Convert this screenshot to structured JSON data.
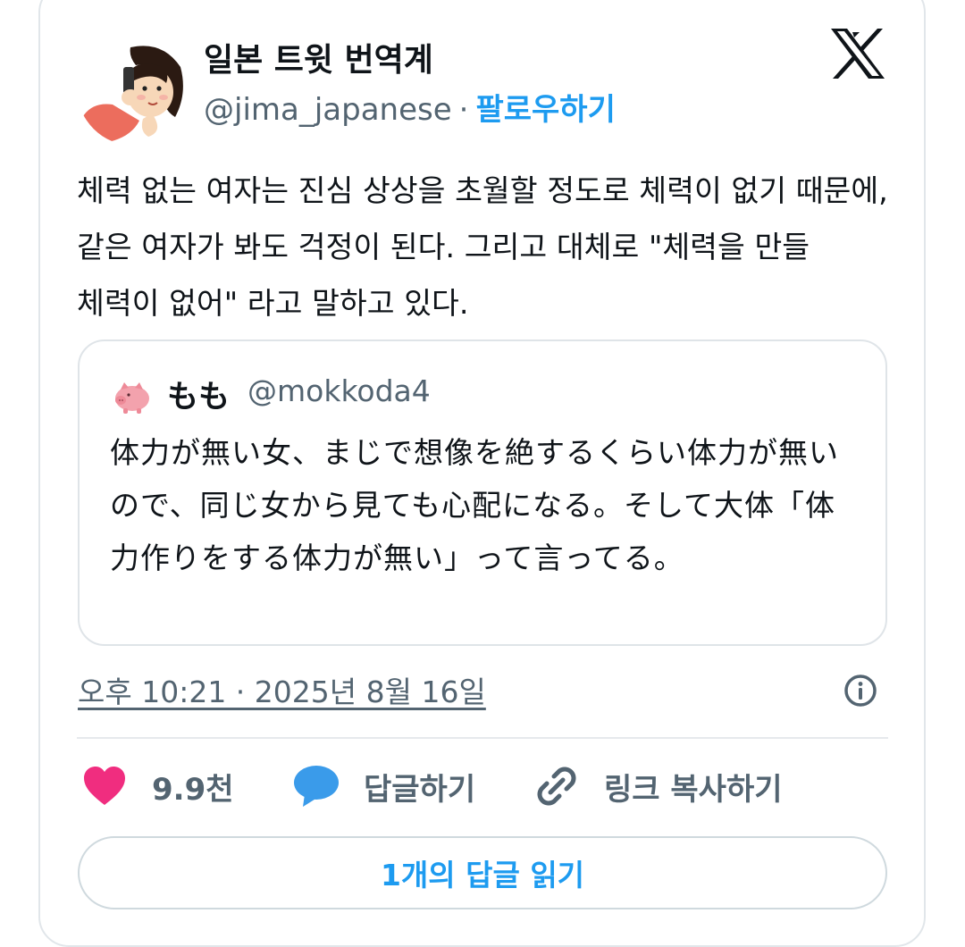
{
  "author": {
    "name": "일본 트윗 번역계",
    "handle": "@jima_japanese",
    "separator": "·",
    "follow_label": "팔로우하기"
  },
  "tweet": {
    "text": "체력 없는 여자는 진심 상상을 초월할 정도로 체력이 없기 때문에, 같은 여자가 봐도 걱정이 된다. 그리고 대체로 \"체력을 만들 체력이 없어\" 라고 말하고 있다."
  },
  "quote": {
    "name": "もも",
    "handle": "@mokkoda4",
    "text": "体力が無い女、まじで想像を絶するくらい体力が無いので、同じ女から見ても心配になる。そして大体「体力作りをする体力が無い」って言ってる。"
  },
  "meta": {
    "timestamp": "오후 10:21 · 2025년 8월 16일"
  },
  "actions": {
    "like_count": "9.9천",
    "reply_label": "답글하기",
    "copy_link_label": "링크 복사하기"
  },
  "read_replies_label": "1개의 답글 읽기",
  "icons": {
    "brand": "x-logo-icon",
    "info": "info-icon",
    "like": "heart-icon",
    "reply": "speech-bubble-icon",
    "link": "link-icon",
    "quote_avatar": "pig-icon"
  },
  "colors": {
    "accent": "#1d9bf0",
    "heart": "#f02d7f",
    "bubble": "#3a9bea",
    "muted": "#536471",
    "text": "#0f1419"
  }
}
